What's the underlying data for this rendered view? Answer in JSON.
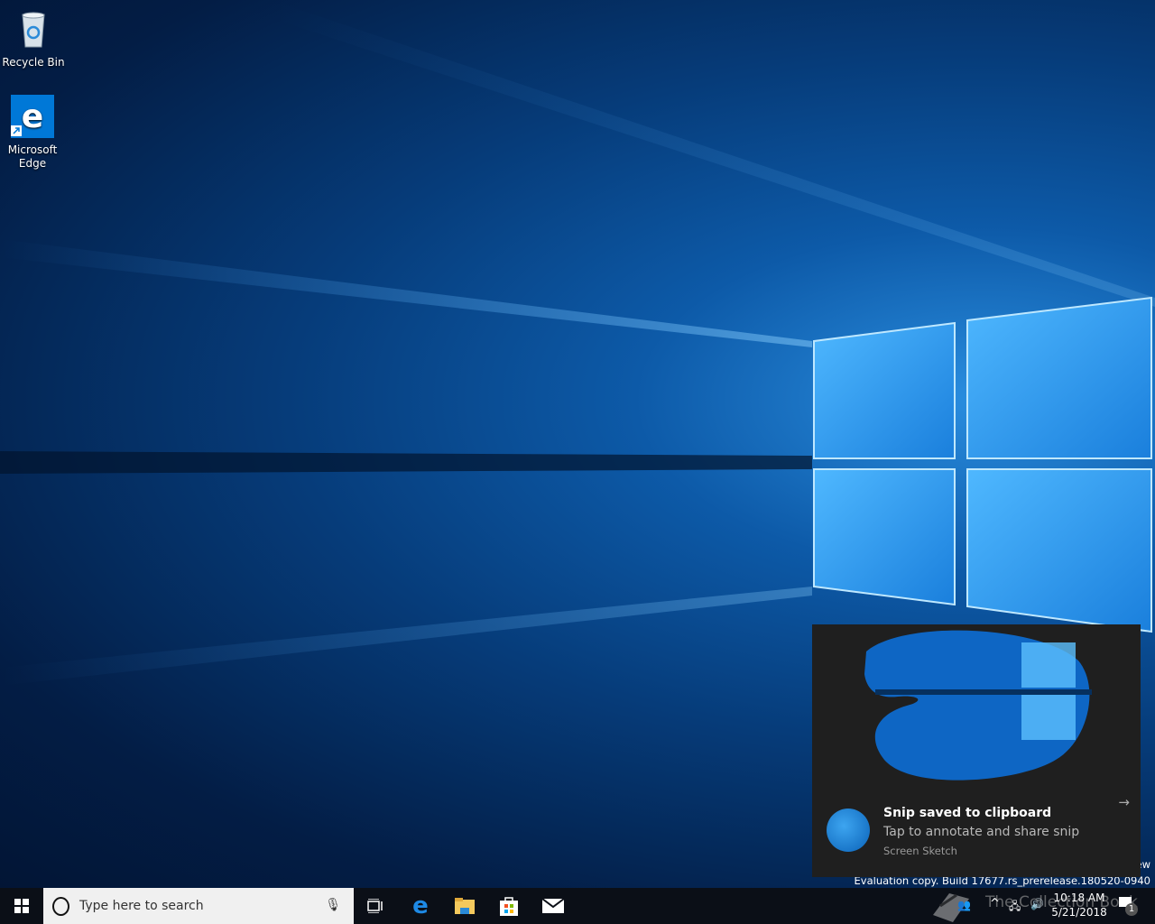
{
  "desktop": {
    "icons": [
      {
        "label": "Recycle Bin",
        "icon": "recycle-bin-icon"
      },
      {
        "label": "Microsoft Edge",
        "icon": "edge-icon"
      }
    ]
  },
  "toast": {
    "title": "Snip saved to clipboard",
    "body": "Tap to annotate and share snip",
    "source": "Screen Sketch",
    "arrow": "→"
  },
  "watermark": {
    "line1_partial": "ew",
    "line2": "Evaluation copy. Build 17677.rs_prerelease.180520-0940"
  },
  "taskbar": {
    "search_placeholder": "Type here to search",
    "pinned": [
      "task-view",
      "edge",
      "file-explorer",
      "store",
      "mail"
    ],
    "clock_time": "10:18 AM",
    "clock_date": "5/21/2018",
    "notification_count": "1",
    "overlay_text": "The Collection Book"
  },
  "colors": {
    "taskbar": "#0b0f17",
    "toast": "#1f1f1f",
    "accent": "#0078d7"
  }
}
